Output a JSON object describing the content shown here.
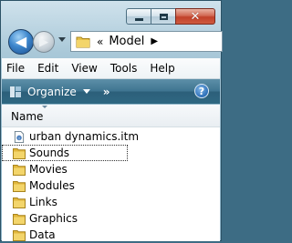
{
  "window": {
    "caption_buttons": {
      "minimize": "–",
      "maximize": "□",
      "close": "✕"
    }
  },
  "nav": {
    "back_icon": "◀",
    "forward_icon": "▶",
    "address": {
      "chevrons": "«",
      "location": "Model",
      "separator": "▶"
    }
  },
  "menu": {
    "items": [
      "File",
      "Edit",
      "View",
      "Tools",
      "Help"
    ]
  },
  "command_bar": {
    "organize_label": "Organize",
    "more_label": "»",
    "help_label": "?"
  },
  "file_list": {
    "column_header": "Name",
    "items": [
      {
        "name": "urban dynamics.itm",
        "type": "file",
        "icon": "document-icon"
      },
      {
        "name": "Sounds",
        "type": "folder",
        "icon": "folder-icon"
      },
      {
        "name": "Movies",
        "type": "folder",
        "icon": "folder-icon"
      },
      {
        "name": "Modules",
        "type": "folder",
        "icon": "folder-icon"
      },
      {
        "name": "Links",
        "type": "folder",
        "icon": "folder-icon"
      },
      {
        "name": "Graphics",
        "type": "folder",
        "icon": "folder-icon"
      },
      {
        "name": "Data",
        "type": "folder",
        "icon": "folder-icon"
      }
    ]
  },
  "colors": {
    "command_bar": "#3f7591",
    "folder": "#e8c24a",
    "close_button": "#c0412a"
  }
}
